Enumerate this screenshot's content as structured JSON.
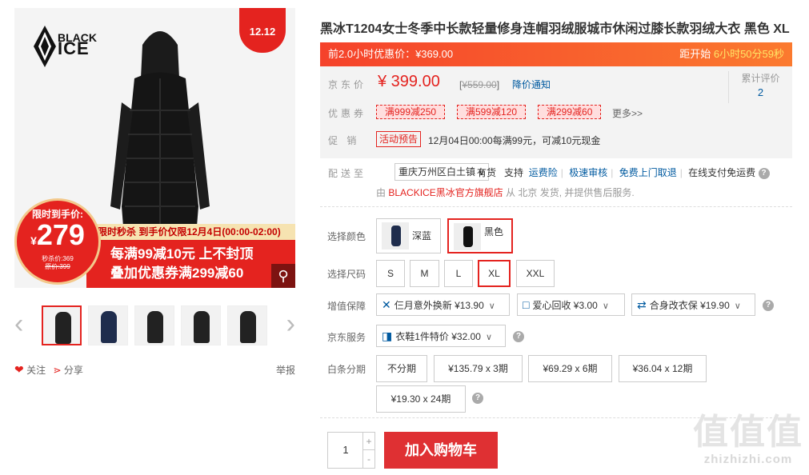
{
  "gallery": {
    "brand_top": "BLACK",
    "brand_bottom": "ICE",
    "badge": "12.12",
    "circle_label": "限时到手价:",
    "circle_price": "279",
    "circle_currency": "¥",
    "circle_sub1": "秒杀价:369",
    "circle_sub2": "原价:399",
    "promo_top": "限时秒杀 到手价仅限12月4日(00:00-02:00)",
    "promo_line1": "每满99减10元 上不封顶",
    "promo_line2": "叠加优惠券满299减60",
    "zoom_icon": "magnifier-icon",
    "thumbs_count": 5,
    "follow_label": "关注",
    "share_label": "分享",
    "report_label": "举报"
  },
  "product": {
    "title": "黑冰T1204女士冬季中长款轻量修身连帽羽绒服城市休闲过膝长款羽绒大衣 黑色 XL"
  },
  "presale": {
    "label": "前2.0小时优惠价：¥369.00",
    "countdown_label": "距开始",
    "countdown_value": "6小时50分59秒"
  },
  "price": {
    "label": "京东价",
    "value": "¥ 399.00",
    "original_prefix": "[",
    "original": "¥559.00",
    "original_suffix": "]",
    "notify": "降价通知",
    "review_label": "累计评价",
    "review_count": "2"
  },
  "coupons": {
    "label": "优惠券",
    "items": [
      "满999减250",
      "满599减120",
      "满299减60"
    ],
    "more": "更多>>"
  },
  "promotion": {
    "label": "促 销",
    "tag": "活动预告",
    "text": "12月04日00:00每满99元，可减10元现金"
  },
  "delivery": {
    "label": "配送至",
    "address": "重庆万州区白土镇 ∨",
    "stock": "有货",
    "support": "支持",
    "services": [
      "运费险",
      "极速审核",
      "免费上门取退",
      "在线支付免运费"
    ],
    "seller_prefix": "由",
    "shop": "BLACKICE黑冰官方旗舰店",
    "seller_suffix": "从 北京 发货, 并提供售后服务."
  },
  "colors": {
    "label": "选择颜色",
    "options": [
      "深蓝",
      "黑色"
    ],
    "selected": "黑色"
  },
  "sizes": {
    "label": "选择尺码",
    "options": [
      "S",
      "M",
      "L",
      "XL",
      "XXL"
    ],
    "selected": "XL"
  },
  "value_added": {
    "label": "增值保障",
    "options": [
      "仨月意外换新 ¥13.90",
      "爱心回收 ¥3.00",
      "合身改衣保 ¥19.90"
    ]
  },
  "jd_service": {
    "label": "京东服务",
    "option": "衣鞋1件特价 ¥32.00"
  },
  "installment": {
    "label": "白条分期",
    "options": [
      "不分期",
      "¥135.79 x 3期",
      "¥69.29 x 6期",
      "¥36.04 x 12期",
      "¥19.30 x 24期"
    ]
  },
  "cart": {
    "quantity": "1",
    "plus": "+",
    "minus": "-",
    "button": "加入购物车"
  },
  "watermark": {
    "big": "值值值",
    "small": "zhizhizhi.com"
  }
}
